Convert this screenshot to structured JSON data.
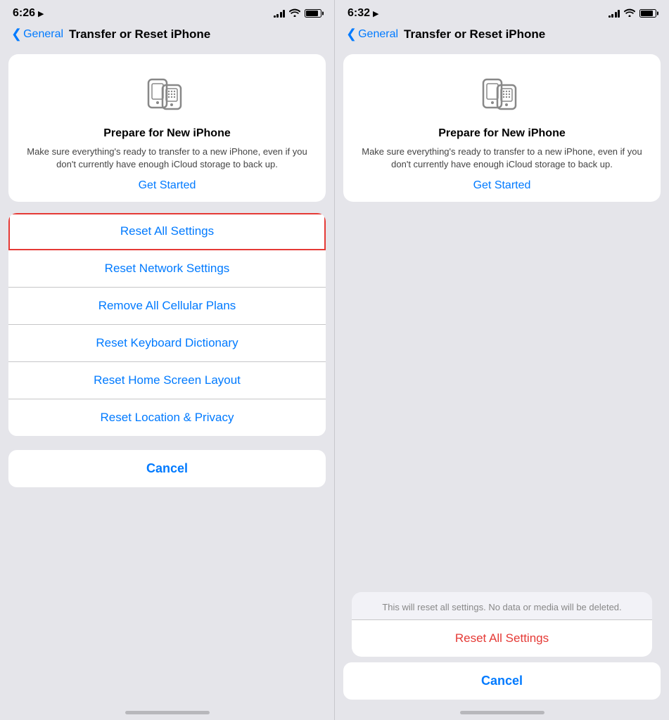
{
  "left": {
    "status": {
      "time": "6:26",
      "location_icon": "▲"
    },
    "nav": {
      "back_label": "General",
      "title": "Transfer or Reset iPhone"
    },
    "prepare_card": {
      "title": "Prepare for New iPhone",
      "description": "Make sure everything's ready to transfer to a new iPhone, even if you don't currently have enough iCloud storage to back up.",
      "get_started": "Get Started"
    },
    "reset_items": [
      {
        "id": "reset-all-settings",
        "label": "Reset All Settings",
        "highlighted": true
      },
      {
        "id": "reset-network-settings",
        "label": "Reset Network Settings",
        "highlighted": false
      },
      {
        "id": "remove-cellular-plans",
        "label": "Remove All Cellular Plans",
        "highlighted": false
      },
      {
        "id": "reset-keyboard-dictionary",
        "label": "Reset Keyboard Dictionary",
        "highlighted": false
      },
      {
        "id": "reset-home-screen",
        "label": "Reset Home Screen Layout",
        "highlighted": false
      },
      {
        "id": "reset-location-privacy",
        "label": "Reset Location & Privacy",
        "highlighted": false
      }
    ],
    "cancel_label": "Cancel"
  },
  "right": {
    "status": {
      "time": "6:32",
      "location_icon": "▲"
    },
    "nav": {
      "back_label": "General",
      "title": "Transfer or Reset iPhone"
    },
    "prepare_card": {
      "title": "Prepare for New iPhone",
      "description": "Make sure everything's ready to transfer to a new iPhone, even if you don't currently have enough iCloud storage to back up.",
      "get_started": "Get Started"
    },
    "confirm_sheet": {
      "description": "This will reset all settings. No data or media will be deleted.",
      "reset_label": "Reset All Settings",
      "cancel_label": "Cancel"
    }
  },
  "icons": {
    "back_chevron": "❮",
    "wifi": "▲",
    "signal": "▲▲▲▲"
  }
}
